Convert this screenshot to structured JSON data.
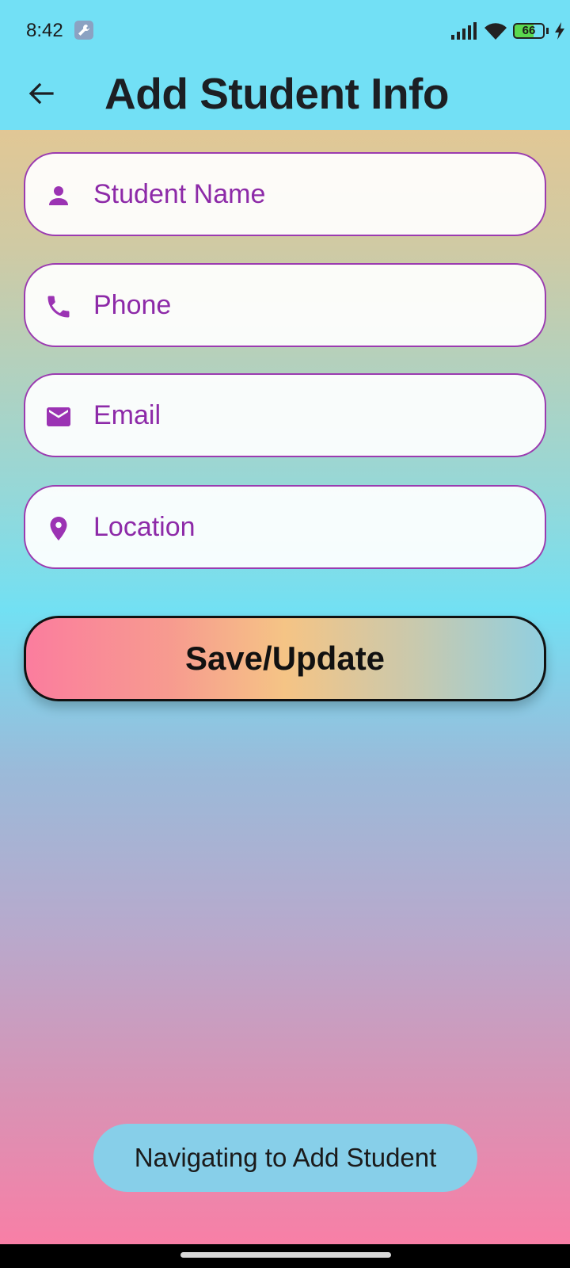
{
  "status_bar": {
    "time": "8:42",
    "battery_level": "66",
    "icons": [
      "wrench-icon",
      "signal-icon",
      "wifi-icon",
      "battery-icon",
      "charging-bolt-icon"
    ]
  },
  "app_bar": {
    "title": "Add Student Info",
    "back_icon": "arrow-left-icon"
  },
  "form": {
    "fields": [
      {
        "placeholder": "Student Name",
        "icon": "person-icon"
      },
      {
        "placeholder": "Phone",
        "icon": "phone-icon"
      },
      {
        "placeholder": "Email",
        "icon": "mail-icon"
      },
      {
        "placeholder": "Location",
        "icon": "location-pin-icon"
      }
    ],
    "save_label": "Save/Update"
  },
  "toast": {
    "message": "Navigating to Add Student"
  },
  "colors": {
    "app_bar": "#72e0f5",
    "field_border": "#9b3bb0",
    "field_text": "#8d2aa8",
    "toast_bg": "#87cfe9"
  }
}
